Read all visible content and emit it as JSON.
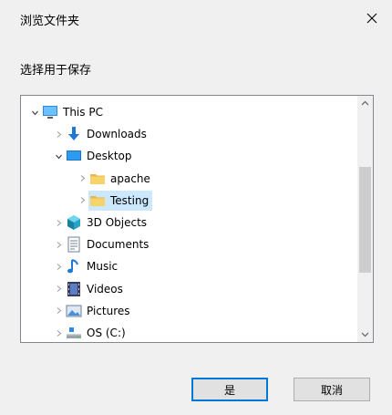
{
  "dialog": {
    "title": "浏览文件夹",
    "prompt": "选择用于保存"
  },
  "tree": {
    "items": [
      {
        "label": "This PC",
        "icon": "this-pc-icon",
        "expanded": true,
        "depth": 0
      },
      {
        "label": "Downloads",
        "icon": "downloads-icon",
        "expanded": false,
        "depth": 1
      },
      {
        "label": "Desktop",
        "icon": "desktop-icon",
        "expanded": true,
        "depth": 1
      },
      {
        "label": "apache",
        "icon": "folder-icon",
        "expanded": false,
        "depth": 2
      },
      {
        "label": "Testing",
        "icon": "folder-icon",
        "expanded": false,
        "depth": 2,
        "selected": true
      },
      {
        "label": "3D Objects",
        "icon": "3d-objects-icon",
        "expanded": false,
        "depth": 1
      },
      {
        "label": "Documents",
        "icon": "documents-icon",
        "expanded": false,
        "depth": 1
      },
      {
        "label": "Music",
        "icon": "music-icon",
        "expanded": false,
        "depth": 1
      },
      {
        "label": "Videos",
        "icon": "videos-icon",
        "expanded": false,
        "depth": 1
      },
      {
        "label": "Pictures",
        "icon": "pictures-icon",
        "expanded": false,
        "depth": 1
      },
      {
        "label": "OS (C:)",
        "icon": "drive-icon",
        "expanded": false,
        "depth": 1
      }
    ]
  },
  "buttons": {
    "ok_label": "是",
    "cancel_label": "取消"
  },
  "colors": {
    "selection": "#cce8ff",
    "accent": "#0078d7"
  }
}
